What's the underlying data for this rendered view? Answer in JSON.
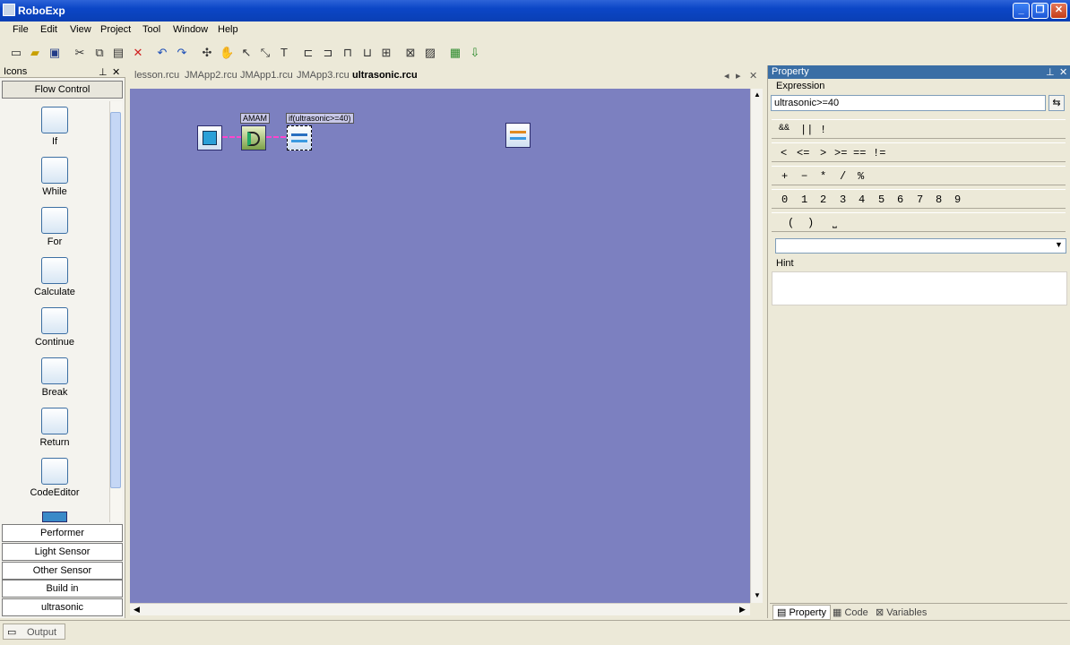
{
  "app": {
    "title": "RoboExp",
    "window_buttons": [
      "_",
      "❐",
      "✕"
    ]
  },
  "menu": [
    "File",
    "Edit",
    "View",
    "Project",
    "Tool",
    "Window",
    "Help"
  ],
  "icons_panel": {
    "title": "Icons",
    "flow_control": "Flow Control",
    "items": [
      "If",
      "While",
      "For",
      "Calculate",
      "Continue",
      "Break",
      "Return",
      "CodeEditor"
    ],
    "categories": [
      "Performer",
      "Light Sensor",
      "Other Sensor",
      "Build in",
      "ultrasonic"
    ]
  },
  "tabs": [
    "lesson.rcu",
    "JMApp2.rcu",
    "JMApp1.rcu",
    "JMApp3.rcu",
    "ultrasonic.rcu"
  ],
  "canvas": {
    "color": "#7c80c0",
    "node_label_1": "AMAM",
    "node_label_2": "if(ultrasonic>=40)"
  },
  "property": {
    "title": "Property",
    "expression_label": "Expression",
    "expression_value": "ultrasonic>=40",
    "logic_ops": [
      "&&",
      "||",
      "!"
    ],
    "compare_ops": [
      "<",
      "<=",
      ">",
      ">=",
      "==",
      "!="
    ],
    "arith_ops": [
      "+",
      "−",
      "*",
      "/",
      "%"
    ],
    "digits": [
      "0",
      "1",
      "2",
      "3",
      "4",
      "5",
      "6",
      "7",
      "8",
      "9"
    ],
    "misc_ops": [
      "(",
      ")",
      "⎵"
    ],
    "hint_label": "Hint",
    "bottom_tabs": [
      "Property",
      "Code",
      "Variables"
    ]
  },
  "status": {
    "output_label": "Output"
  }
}
